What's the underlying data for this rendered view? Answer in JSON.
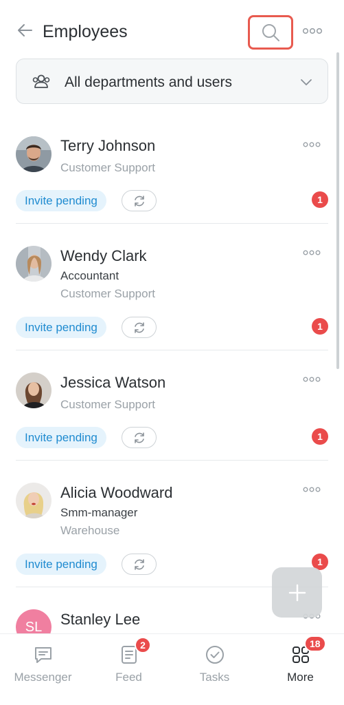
{
  "header": {
    "title": "Employees",
    "back_icon": "arrow-left-icon",
    "search_icon": "search-icon",
    "menu_icon": "more-dots-icon"
  },
  "filter": {
    "label": "All departments and users",
    "icon": "users-icon",
    "chevron": "chevron-down-icon"
  },
  "employees": [
    {
      "name": "Terry Johnson",
      "role": "",
      "department": "Customer Support",
      "invite_status": "Invite pending",
      "notifications": "1"
    },
    {
      "name": "Wendy Clark",
      "role": "Accountant",
      "department": "Customer Support",
      "invite_status": "Invite pending",
      "notifications": "1"
    },
    {
      "name": "Jessica Watson",
      "role": "",
      "department": "Customer Support",
      "invite_status": "Invite pending",
      "notifications": "1"
    },
    {
      "name": "Alicia Woodward",
      "role": "Smm-manager",
      "department": "Warehouse",
      "invite_status": "Invite pending",
      "notifications": "1"
    },
    {
      "name": "Stanley Lee",
      "initials": "SL"
    }
  ],
  "tabbar": {
    "tabs": [
      {
        "label": "Messenger",
        "icon": "chat-icon",
        "badge": ""
      },
      {
        "label": "Feed",
        "icon": "feed-icon",
        "badge": "2"
      },
      {
        "label": "Tasks",
        "icon": "check-circle-icon",
        "badge": ""
      },
      {
        "label": "More",
        "icon": "grid-icon",
        "badge": "18",
        "active": true
      }
    ]
  },
  "colors": {
    "accent_red": "#ea4b4b",
    "pill_blue": "#1f8bd0",
    "pill_bg": "#e5f3fc",
    "highlight_border": "#e85a4f"
  }
}
